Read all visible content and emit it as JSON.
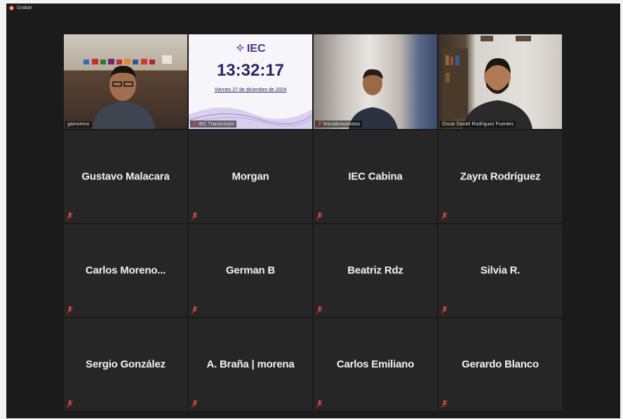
{
  "recording": {
    "label": "Grabar"
  },
  "iec_screen": {
    "logo": "IEC",
    "clock": "13:32:17",
    "date": "Viernes 27 de diciembre de 2024"
  },
  "video_tiles": [
    {
      "label": "gamoreno"
    },
    {
      "label": "IEC Transmisión"
    },
    {
      "label": "leticiabravoostos"
    },
    {
      "label": "Óscar Daniel Rodríguez Fuentes"
    }
  ],
  "name_tiles": [
    {
      "name": "Gustavo Malacara"
    },
    {
      "name": "Morgan"
    },
    {
      "name": "IEC Cabina"
    },
    {
      "name": "Zayra Rodríguez"
    },
    {
      "name": "Carlos  Moreno..."
    },
    {
      "name": "German B"
    },
    {
      "name": "Beatriz Rdz"
    },
    {
      "name": "Silvia R."
    },
    {
      "name": "Sergio González"
    },
    {
      "name": "A. Braña | morena"
    },
    {
      "name": "Carlos Emiliano"
    },
    {
      "name": "Gerardo Blanco"
    }
  ],
  "colors": {
    "active_speaker": "#c7d63c",
    "muted_icon": "#d8463c",
    "tile_bg": "#262626"
  },
  "icons": {
    "recording": "record-dot-icon",
    "muted": "mic-muted-icon"
  }
}
